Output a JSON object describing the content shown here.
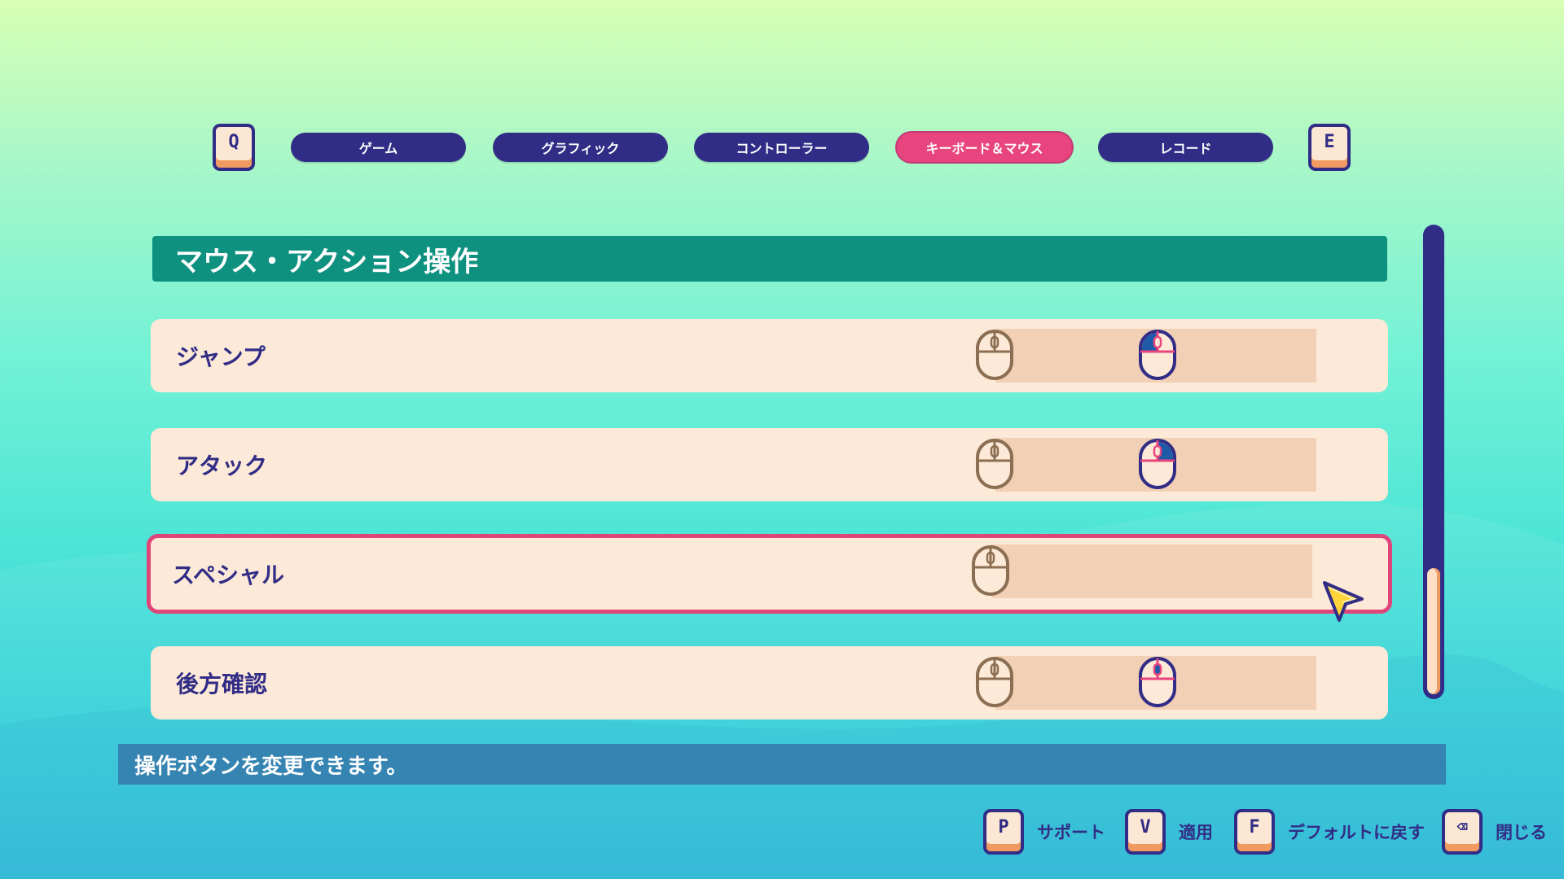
{
  "tabs": {
    "prev_key": "Q",
    "next_key": "E",
    "items": [
      {
        "label": "ゲーム"
      },
      {
        "label": "グラフィック"
      },
      {
        "label": "コントローラー"
      },
      {
        "label": "キーボード＆マウス"
      },
      {
        "label": "レコード"
      }
    ],
    "active_index": 3
  },
  "section": {
    "title": "マウス・アクション操作"
  },
  "rows": [
    {
      "label": "ジャンプ",
      "primary_binding": "mouse-unassigned-icon",
      "secondary_binding": "mouse-left-button-icon"
    },
    {
      "label": "アタック",
      "primary_binding": "mouse-unassigned-icon",
      "secondary_binding": "mouse-right-button-icon"
    },
    {
      "label": "スペシャル",
      "primary_binding": "mouse-unassigned-icon",
      "secondary_binding": ""
    },
    {
      "label": "後方確認",
      "primary_binding": "mouse-unassigned-icon",
      "secondary_binding": "mouse-wheel-button-icon"
    }
  ],
  "selected_row": 2,
  "scroll_position": 0.84,
  "description": "操作ボタンを変更できます。",
  "footer": [
    {
      "key": "P",
      "label": "サポート"
    },
    {
      "key": "V",
      "label": "適用"
    },
    {
      "key": "F",
      "label": "デフォルトに戻す"
    },
    {
      "key": "⌫",
      "label": "閉じる"
    }
  ],
  "colors": {
    "navy": "#312d86",
    "accent_pink": "#e8447e",
    "header_teal": "#0f9180",
    "row_bg": "#fde9d7",
    "binding_bg": "#f2d0b6",
    "desc_bar": "#3584b2",
    "mouse_outline_unassigned": "#8c6f52",
    "mouse_highlight": "#1f5aa8"
  }
}
